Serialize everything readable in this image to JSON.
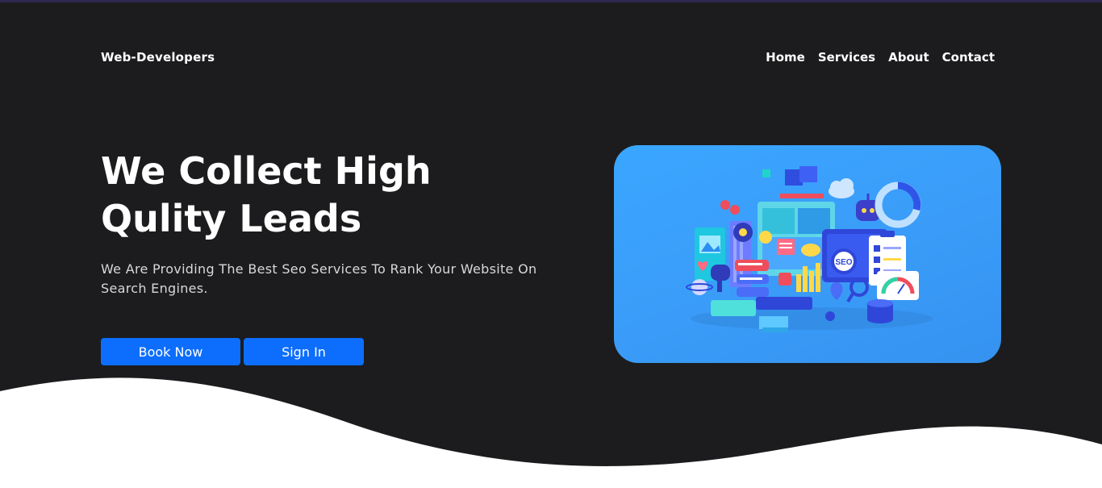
{
  "brand": {
    "name": "Web-Developers"
  },
  "nav": {
    "items": [
      {
        "label": "Home"
      },
      {
        "label": "Services"
      },
      {
        "label": "About"
      },
      {
        "label": "Contact"
      }
    ]
  },
  "hero": {
    "title_line1": "We Collect High",
    "title_line2": "Qulity Leads",
    "subtitle": "We Are Providing The Best Seo Services To Rank Your Website On Search Engines.",
    "primary_button": "Book Now",
    "secondary_button": "Sign In",
    "illustration": {
      "badge_text": "SEO",
      "icon": "seo-3d-illustration"
    }
  },
  "colors": {
    "background": "#1c1c1e",
    "accent": "#0d6efd",
    "card": "#3aa6ff",
    "wave": "#ffffff"
  }
}
